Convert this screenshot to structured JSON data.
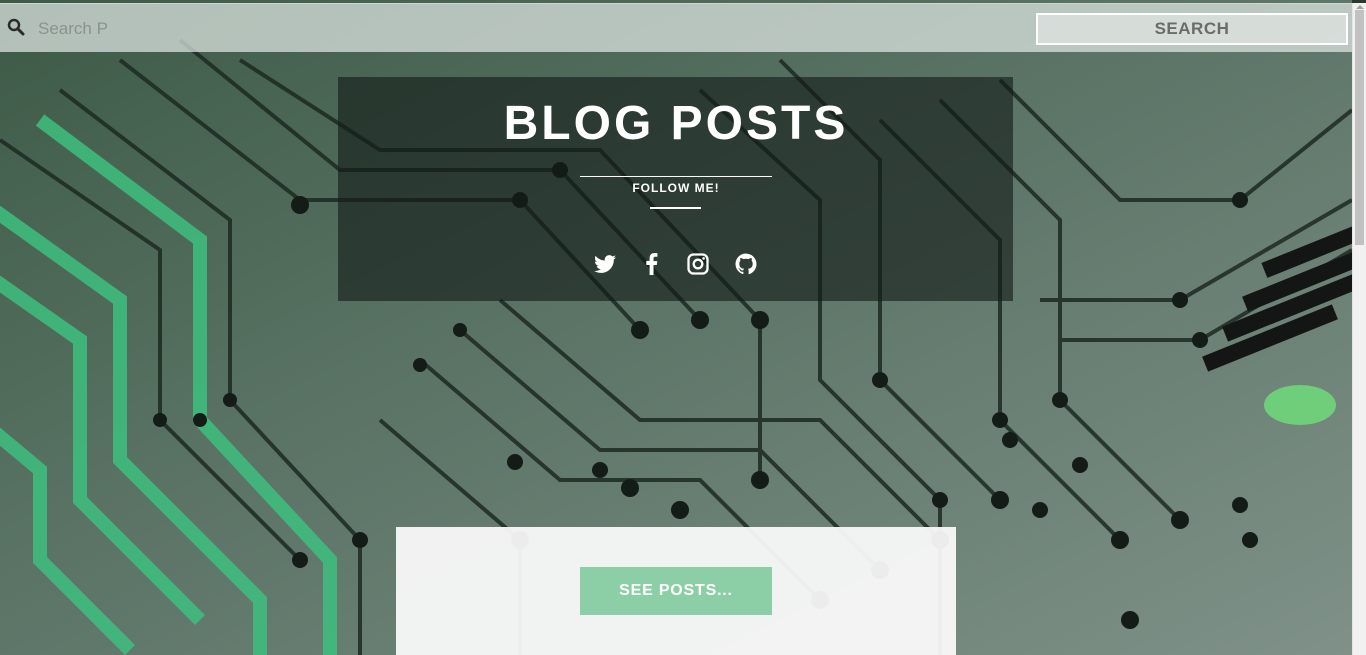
{
  "search": {
    "placeholder": "Search P",
    "value": "",
    "button_label": "SEARCH",
    "icon": "search-icon"
  },
  "header": {
    "title": "BLOG POSTS",
    "subtitle": "FOLLOW ME!"
  },
  "social": [
    {
      "icon": "twitter-icon"
    },
    {
      "icon": "facebook-icon"
    },
    {
      "icon": "instagram-icon"
    },
    {
      "icon": "github-icon"
    }
  ],
  "content": {
    "see_posts_label": "SEE POSTS..."
  },
  "colors": {
    "accent": "#8ccfa6",
    "board_dark": "#1e2a22",
    "board_trace": "#3fbf7f"
  }
}
